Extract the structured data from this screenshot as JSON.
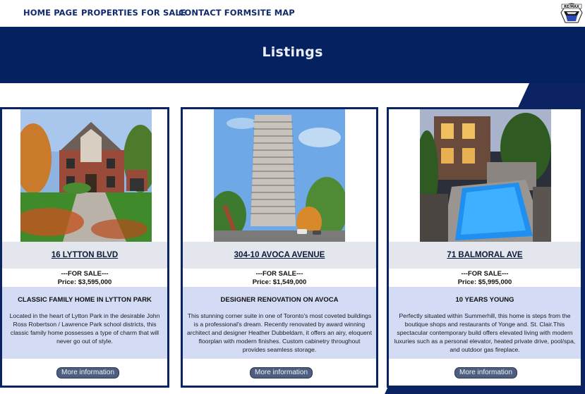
{
  "nav": {
    "items": [
      {
        "label": "HOME PAGE"
      },
      {
        "label": "PROPERTIES FOR SALE"
      },
      {
        "label": "CONTACT FORM"
      },
      {
        "label": "SITE MAP"
      }
    ],
    "logo_text": "RE/MAX"
  },
  "banner": {
    "title": "Listings"
  },
  "listings": [
    {
      "address": "16 LYTTON BLVD",
      "status": "---FOR SALE---",
      "price": "Price: $3,595,000",
      "headline": "CLASSIC FAMILY HOME IN LYTTON PARK",
      "description": "Located in the heart of Lytton Park in the desirable John Ross Robertson / Lawrence Park school districts, this classic family home possesses a type of charm that will never go out of style.",
      "button": "More information",
      "photo": "brick-house-photo"
    },
    {
      "address": "304-10 AVOCA AVENUE",
      "status": "---FOR SALE---",
      "price": "Price: $1,549,000",
      "headline": "DESIGNER RENOVATION ON AVOCA",
      "description": "This stunning corner suite in one of Toronto's most coveted buildings is a professional's dream. Recently renovated by award winning architect and designer Heather Dubbeldam, it offers an airy, eloquent floorplan with modern finishes. Custom cabinetry throughout provides seamless storage.",
      "button": "More information",
      "photo": "condo-tower-photo"
    },
    {
      "address": "71 BALMORAL AVE",
      "status": "---FOR SALE---",
      "price": "Price: $5,995,000",
      "headline": "10 YEARS YOUNG",
      "description": "Perfectly situated within Summerhill, this home is steps from the boutique shops and restaurants of Yonge and. St. Clair.This spectacular contemporary build offers elevated living with modern luxuries such as a personal elevator, heated private drive, pool/spa, and outdoor gas fireplace.",
      "button": "More information",
      "photo": "pool-house-photo"
    }
  ],
  "colors": {
    "navy": "#06215f",
    "nav_text": "#102a6b",
    "card_border": "#0a2462",
    "desc_band": "#d4dcf5",
    "button": "#4e5e7e"
  }
}
